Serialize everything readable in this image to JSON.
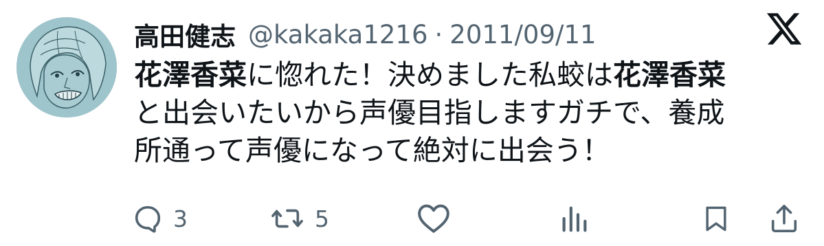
{
  "tweet": {
    "display_name": "高田健志",
    "handle": "@kakaka1216",
    "separator": "·",
    "date": "2011/09/11",
    "lines": [
      [
        {
          "text": "花澤香菜",
          "bold": true
        },
        {
          "text": "に惚れた！決めました私蛟は",
          "bold": false
        },
        {
          "text": "花澤香菜",
          "bold": true
        }
      ],
      [
        {
          "text": "と出会いたいから声優目指しますガチで、養成",
          "bold": false
        }
      ],
      [
        {
          "text": "所通って声優になって絶対に出会う！",
          "bold": false
        }
      ]
    ]
  },
  "actions": {
    "reply_count": "3",
    "retweet_count": "5"
  },
  "icons": {
    "avatar": "avatar-sketch",
    "logo": "x-logo-icon",
    "reply": "reply-icon",
    "retweet": "retweet-icon",
    "like": "heart-icon",
    "views": "views-icon",
    "bookmark": "bookmark-icon",
    "share": "share-icon"
  },
  "colors": {
    "text": "#0f1419",
    "muted": "#536471",
    "avatar_bg": "#9fc5cc"
  }
}
